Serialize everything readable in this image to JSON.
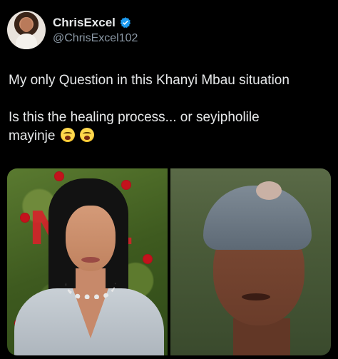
{
  "author": {
    "display_name": "ChrisExcel",
    "handle": "@ChrisExcel102",
    "verified": true,
    "verified_color": "#1d9bf0"
  },
  "tweet": {
    "line1": "My only Question in this Khanyi Mbau situation",
    "line2": "Is this the healing process... or seyipholile",
    "line3": "mayinje",
    "emojis": [
      "weary-face-emoji",
      "weary-face-emoji"
    ]
  },
  "media": {
    "left_photo_sign_text": "NFL",
    "colors": {
      "background": "#000000",
      "text": "#e7e9ea",
      "secondary_text": "#8b98a5"
    }
  }
}
